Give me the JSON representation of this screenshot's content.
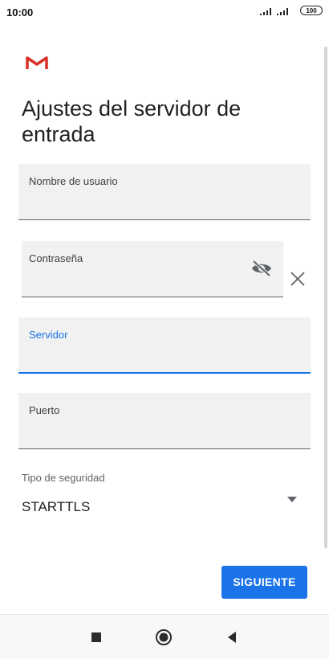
{
  "status_bar": {
    "time": "10:00",
    "battery": "100"
  },
  "title": "Ajustes del servidor de entrada",
  "fields": {
    "username": {
      "label": "Nombre de usuario",
      "value": ""
    },
    "password": {
      "label": "Contraseña",
      "value": ""
    },
    "server": {
      "label": "Servidor",
      "value": ""
    },
    "port": {
      "label": "Puerto",
      "value": ""
    }
  },
  "security": {
    "label": "Tipo de seguridad",
    "value": "STARTTLS"
  },
  "next_button": {
    "label": "SIGUIENTE"
  },
  "colors": {
    "accent": "#1a73e8",
    "field_bg": "#f1f1f1",
    "logo_red": "#d93025"
  },
  "icons": [
    "gmail-logo",
    "eye-off-icon",
    "close-icon",
    "dropdown-arrow-icon",
    "nav-square-icon",
    "nav-circle-icon",
    "nav-back-icon"
  ]
}
